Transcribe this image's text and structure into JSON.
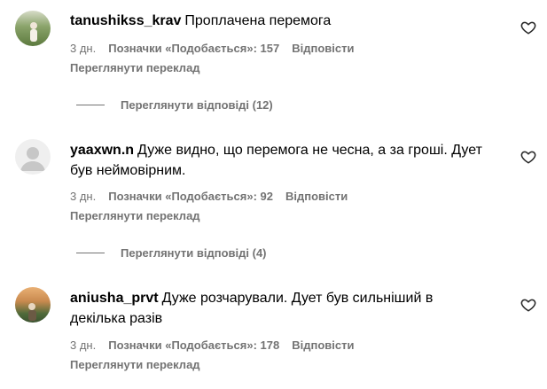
{
  "comments": [
    {
      "username": "tanushikss_krav",
      "text": "Проплачена перемога",
      "time": "3 дн.",
      "likes": "Позначки «Подобається»: 157",
      "reply": "Відповісти",
      "translate": "Переглянути переклад",
      "view_replies": "Переглянути відповіді (12)",
      "avatar_icon": "user-photo-icon"
    },
    {
      "username": "yaaxwn.n",
      "text": "Дуже видно, що перемога не чесна, а за гроші. Дует був неймовірним.",
      "time": "3 дн.",
      "likes": "Позначки «Подобається»: 92",
      "reply": "Відповісти",
      "translate": "Переглянути переклад",
      "view_replies": "Переглянути відповіді (4)",
      "avatar_icon": "default-avatar-icon"
    },
    {
      "username": "aniusha_prvt",
      "text": "Дуже розчарували. Дует був сильніший в декілька разів",
      "time": "3 дн.",
      "likes": "Позначки «Подобається»: 178",
      "reply": "Відповісти",
      "translate": "Переглянути переклад",
      "avatar_icon": "user-photo-icon"
    }
  ],
  "colors": {
    "secondary_text": "#737373",
    "primary_text": "#000000",
    "background": "#ffffff"
  }
}
